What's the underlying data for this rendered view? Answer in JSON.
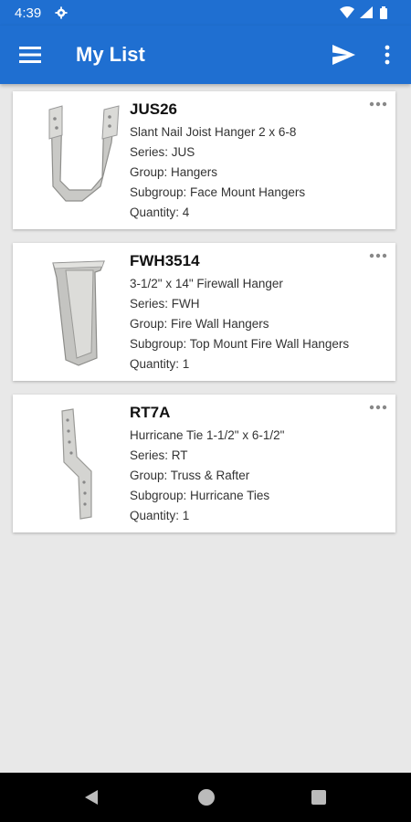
{
  "status_bar": {
    "time": "4:39"
  },
  "app_bar": {
    "title": "My List"
  },
  "items": [
    {
      "name": "JUS26",
      "description": "Slant Nail Joist Hanger 2 x 6-8",
      "series": "Series: JUS",
      "group": "Group: Hangers",
      "subgroup": "Subgroup: Face Mount Hangers",
      "quantity": "Quantity: 4"
    },
    {
      "name": "FWH3514",
      "description": "3-1/2\" x 14\" Firewall Hanger",
      "series": "Series: FWH",
      "group": "Group: Fire Wall Hangers",
      "subgroup": "Subgroup: Top Mount Fire Wall Hangers",
      "quantity": "Quantity: 1"
    },
    {
      "name": "RT7A",
      "description": "Hurricane Tie 1-1/2\" x 6-1/2\"",
      "series": "Series: RT",
      "group": "Group: Truss & Rafter",
      "subgroup": "Subgroup: Hurricane Ties",
      "quantity": "Quantity: 1"
    }
  ],
  "colors": {
    "app_bar": "#1f6fd1",
    "background": "#e8e8e8",
    "card": "#ffffff"
  }
}
